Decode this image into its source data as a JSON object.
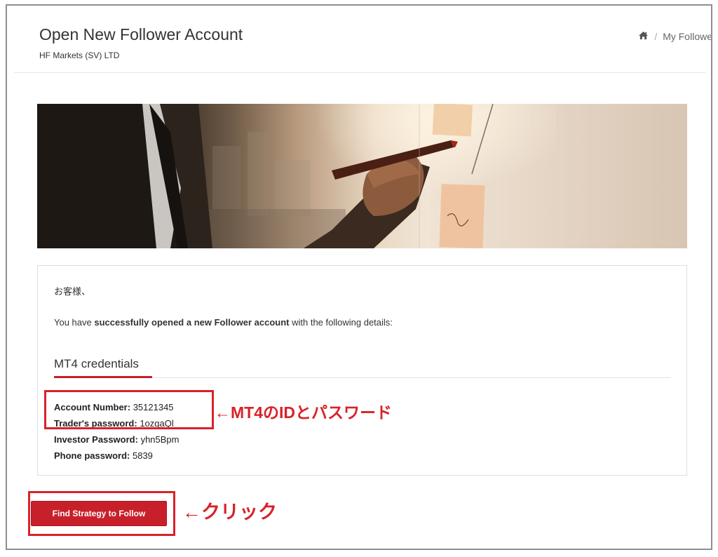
{
  "header": {
    "title": "Open New Follower Account",
    "subtitle": "HF Markets (SV) LTD",
    "breadcrumb": {
      "home_icon": "home-icon",
      "separator": "/",
      "current": "My Followe"
    }
  },
  "message": {
    "greeting": "お客様、",
    "prefix": "You have ",
    "bold": "successfully opened a new Follower account",
    "suffix": " with the following details:"
  },
  "credentials": {
    "title": "MT4 credentials",
    "rows": [
      {
        "label": "Account Number:",
        "value": "35121345"
      },
      {
        "label": "Trader's password:",
        "value": "1ozgaQl"
      },
      {
        "label": "Investor Password:",
        "value": "yhn5Bpm"
      },
      {
        "label": "Phone password:",
        "value": "5839"
      }
    ]
  },
  "annotations": {
    "credentials_note": "←MT4のIDとパスワード",
    "button_note": "←クリック"
  },
  "actions": {
    "find_strategy_label": "Find Strategy to Follow"
  },
  "colors": {
    "accent_red": "#c8202a",
    "annotation_red": "#d9222a"
  }
}
